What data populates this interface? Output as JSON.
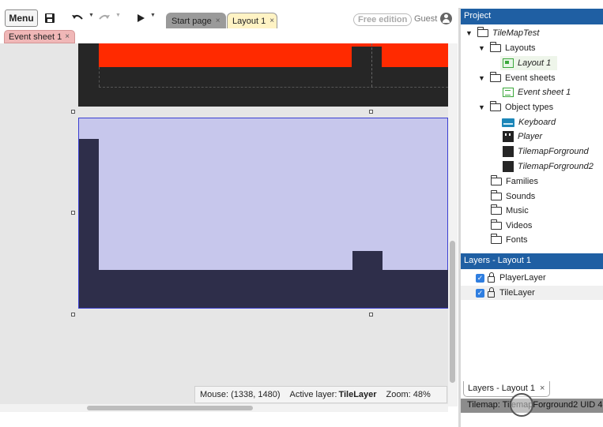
{
  "toolbar": {
    "menu_label": "Menu",
    "tabs": [
      {
        "label": "Start page",
        "close": "×"
      },
      {
        "label": "Layout 1",
        "close": "×"
      }
    ],
    "edition_badge": "Free edition",
    "user_label": "Guest"
  },
  "event_sheet_tab": {
    "label": "Event sheet 1",
    "close": "×"
  },
  "statusbar": {
    "mouse": "Mouse: (1338, 1480)",
    "active_layer_prefix": "Active layer:",
    "active_layer": "TileLayer",
    "zoom": "Zoom: 48%"
  },
  "project": {
    "header": "Project",
    "root": "TileMapTest",
    "layouts_folder": "Layouts",
    "layout_item": "Layout 1",
    "event_sheets_folder": "Event sheets",
    "event_sheet_item": "Event sheet 1",
    "object_types_folder": "Object types",
    "objects": [
      "Keyboard",
      "Player",
      "TilemapForground",
      "TilemapForground2"
    ],
    "folders": [
      "Families",
      "Sounds",
      "Music",
      "Videos",
      "Fonts"
    ]
  },
  "layers": {
    "header": "Layers - Layout 1",
    "items": [
      "PlayerLayer",
      "TileLayer"
    ],
    "tab_label": "Layers - Layout 1",
    "tab_close": "×"
  },
  "properties_bar": "Tilemap: TilemapForground2 UID 4",
  "colors": {
    "panel_header": "#1f5fa3",
    "red_band": "#ff2a00",
    "tilemap_selected": "#c7c7ec",
    "tile_dark": "#2e2e4a"
  }
}
